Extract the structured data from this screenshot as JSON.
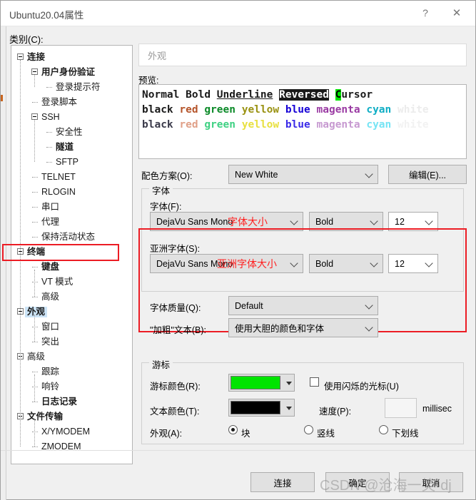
{
  "window": {
    "title": "Ubuntu20.04属性",
    "help_icon": "?",
    "close_icon": "✕"
  },
  "category": {
    "label": "类别(C):",
    "tree": [
      {
        "label": "连接",
        "depth": 0,
        "bold": true,
        "expander": "minus"
      },
      {
        "label": "用户身份验证",
        "depth": 1,
        "bold": true,
        "expander": "minus"
      },
      {
        "label": "登录提示符",
        "depth": 2,
        "bold": false,
        "expander": "none"
      },
      {
        "label": "登录脚本",
        "depth": 1,
        "bold": false,
        "expander": "none"
      },
      {
        "label": "SSH",
        "depth": 1,
        "bold": false,
        "expander": "minus"
      },
      {
        "label": "安全性",
        "depth": 2,
        "bold": false,
        "expander": "none"
      },
      {
        "label": "隧道",
        "depth": 2,
        "bold": true,
        "expander": "none"
      },
      {
        "label": "SFTP",
        "depth": 2,
        "bold": false,
        "expander": "none"
      },
      {
        "label": "TELNET",
        "depth": 1,
        "bold": false,
        "expander": "none"
      },
      {
        "label": "RLOGIN",
        "depth": 1,
        "bold": false,
        "expander": "none"
      },
      {
        "label": "串口",
        "depth": 1,
        "bold": false,
        "expander": "none"
      },
      {
        "label": "代理",
        "depth": 1,
        "bold": false,
        "expander": "none"
      },
      {
        "label": "保持活动状态",
        "depth": 1,
        "bold": false,
        "expander": "none"
      },
      {
        "label": "终端",
        "depth": 0,
        "bold": true,
        "expander": "minus"
      },
      {
        "label": "键盘",
        "depth": 1,
        "bold": true,
        "expander": "none"
      },
      {
        "label": "VT 模式",
        "depth": 1,
        "bold": false,
        "expander": "none"
      },
      {
        "label": "高级",
        "depth": 1,
        "bold": false,
        "expander": "none"
      },
      {
        "label": "外观",
        "depth": 0,
        "bold": true,
        "expander": "minus",
        "selected": true
      },
      {
        "label": "窗口",
        "depth": 1,
        "bold": false,
        "expander": "none"
      },
      {
        "label": "突出",
        "depth": 1,
        "bold": false,
        "expander": "none"
      },
      {
        "label": "高级",
        "depth": 0,
        "bold": false,
        "expander": "minus"
      },
      {
        "label": "跟踪",
        "depth": 1,
        "bold": false,
        "expander": "none"
      },
      {
        "label": "响铃",
        "depth": 1,
        "bold": false,
        "expander": "none"
      },
      {
        "label": "日志记录",
        "depth": 1,
        "bold": true,
        "expander": "none"
      },
      {
        "label": "文件传输",
        "depth": 0,
        "bold": true,
        "expander": "minus"
      },
      {
        "label": "X/YMODEM",
        "depth": 1,
        "bold": false,
        "expander": "none"
      },
      {
        "label": "ZMODEM",
        "depth": 1,
        "bold": false,
        "expander": "none"
      }
    ]
  },
  "page": {
    "header_title": "外观",
    "preview_label": "预览:",
    "preview": {
      "line1": [
        {
          "text": "Normal",
          "color": "#1a1a1a",
          "style": "plain"
        },
        {
          "text": "Bold",
          "color": "#1a1a1a",
          "style": "plain"
        },
        {
          "text": "Underline",
          "color": "#1a1a1a",
          "style": "underline"
        },
        {
          "text": "Reversed",
          "color": "#ffffff",
          "style": "reversed",
          "bg": "#1a1a1a"
        },
        {
          "text": "C",
          "color": "#000000",
          "style": "cursor",
          "bg": "#00e400"
        },
        {
          "text": "ursor",
          "color": "#1a1a1a",
          "style": "plain"
        }
      ],
      "line2": [
        {
          "text": "black",
          "color": "#1a1a1a"
        },
        {
          "text": "red",
          "color": "#b5542a"
        },
        {
          "text": "green",
          "color": "#0b8a28"
        },
        {
          "text": "yellow",
          "color": "#9a9212"
        },
        {
          "text": "blue",
          "color": "#1500d6"
        },
        {
          "text": "magenta",
          "color": "#9a3ba3"
        },
        {
          "text": "cyan",
          "color": "#0eadc4"
        },
        {
          "text": "white",
          "color": "#ececec"
        }
      ],
      "line3": [
        {
          "text": "black",
          "color": "#3a3a4a"
        },
        {
          "text": "red",
          "color": "#e0a088"
        },
        {
          "text": "green",
          "color": "#3fd183"
        },
        {
          "text": "yellow",
          "color": "#e8e040"
        },
        {
          "text": "blue",
          "color": "#3a2ae8"
        },
        {
          "text": "magenta",
          "color": "#c79ad1"
        },
        {
          "text": "cyan",
          "color": "#76e4f4"
        },
        {
          "text": "white",
          "color": "#f2f2f2"
        }
      ]
    },
    "color_scheme": {
      "label": "配色方案(O):",
      "value": "New White",
      "edit_button": "编辑(E)..."
    },
    "font_group": {
      "title": "字体",
      "font_label": "字体(F):",
      "font_name": "DejaVu Sans Mono",
      "font_annotation": "字体大小",
      "font_style": "Bold",
      "font_size": "12",
      "asian_label": "亚洲字体(S):",
      "asian_name": "DejaVu Sans Mono",
      "asian_annotation": "亚洲字体大小",
      "asian_style": "Bold",
      "asian_size": "12",
      "quality_label": "字体质量(Q):",
      "quality_value": "Default",
      "bold_label": "\"加粗\"文本(B):",
      "bold_value": "使用大胆的颜色和字体"
    },
    "cursor_group": {
      "title": "游标",
      "cursor_color_label": "游标颜色(R):",
      "cursor_color": "#00e400",
      "text_color_label": "文本颜色(T):",
      "text_color": "#000000",
      "blink_checkbox": "使用闪烁的光标(U)",
      "blink_checked": false,
      "speed_label": "速度(P):",
      "speed_value": "",
      "speed_unit": "millisec",
      "appearance_label": "外观(A):",
      "options": [
        {
          "label": "块",
          "selected": true
        },
        {
          "label": "竖线",
          "selected": false
        },
        {
          "label": "下划线",
          "selected": false
        }
      ]
    }
  },
  "footer": {
    "connect": "连接",
    "ok": "确定",
    "cancel": "取消"
  },
  "watermark": "CSDN @沧海一笑-dj"
}
